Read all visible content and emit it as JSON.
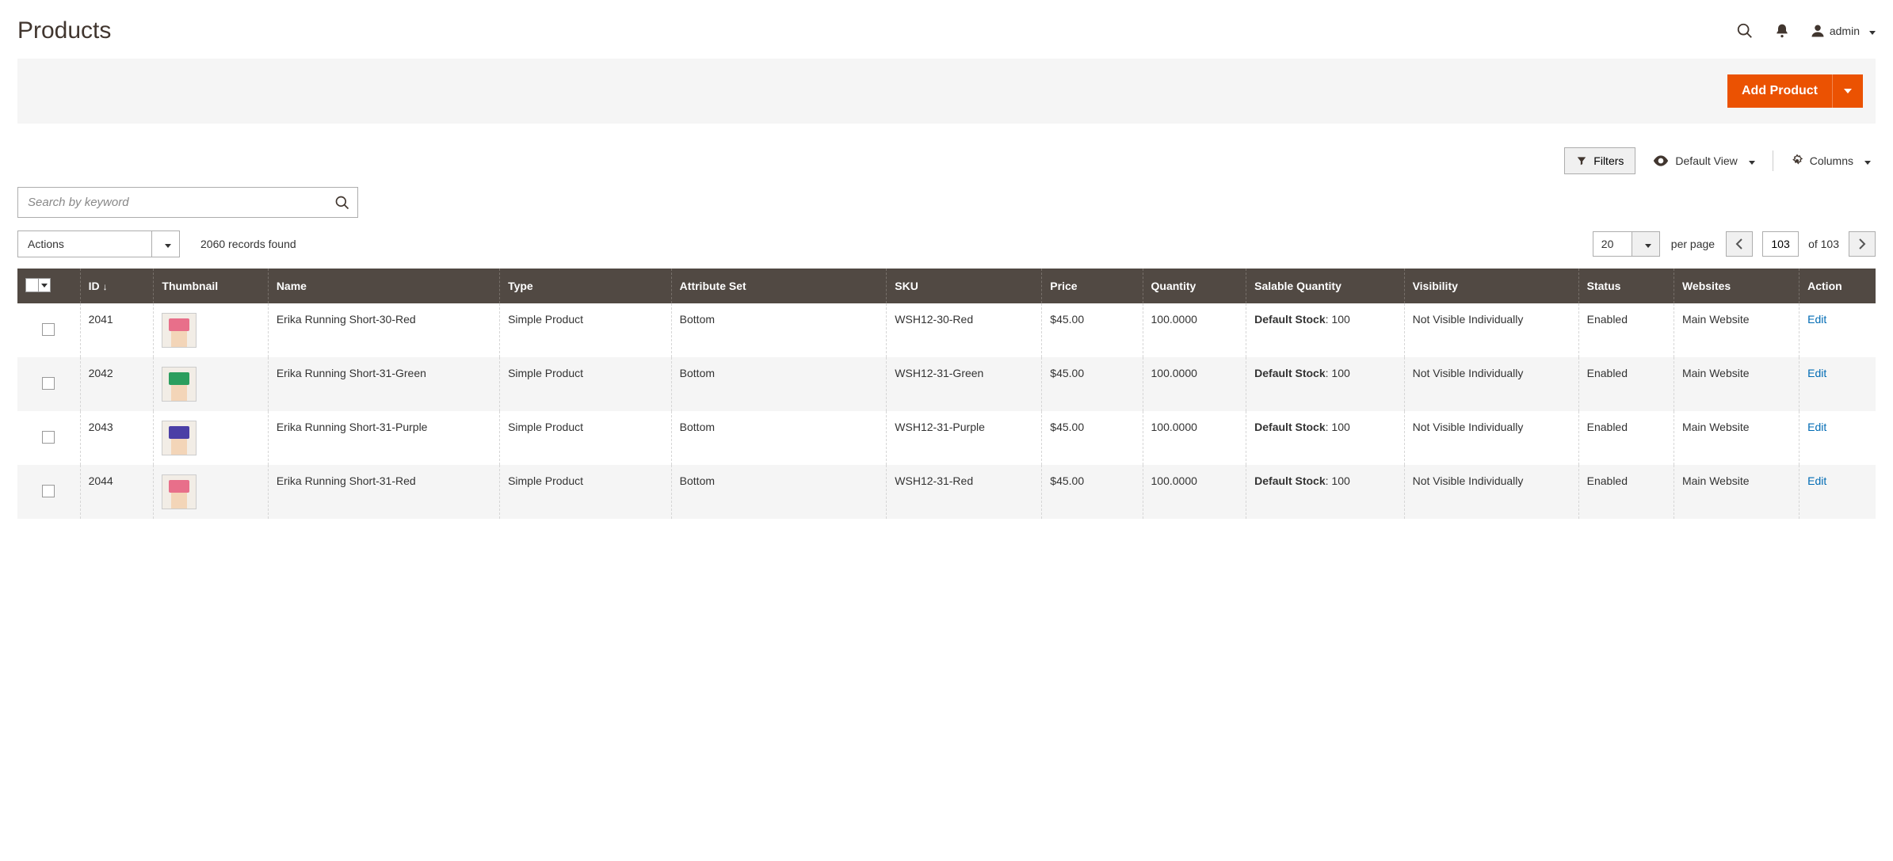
{
  "header": {
    "title": "Products",
    "admin_label": "admin"
  },
  "add_button": {
    "label": "Add Product"
  },
  "toolbar": {
    "filters": "Filters",
    "default_view": "Default View",
    "columns": "Columns"
  },
  "search": {
    "placeholder": "Search by keyword"
  },
  "actions": {
    "label": "Actions"
  },
  "records": {
    "text": "2060 records found"
  },
  "pagination": {
    "page_size": "20",
    "per_page_label": "per page",
    "current_page": "103",
    "of_label": "of 103"
  },
  "columns": {
    "id": "ID",
    "thumbnail": "Thumbnail",
    "name": "Name",
    "type": "Type",
    "attribute_set": "Attribute Set",
    "sku": "SKU",
    "price": "Price",
    "quantity": "Quantity",
    "salable_quantity": "Salable Quantity",
    "visibility": "Visibility",
    "status": "Status",
    "websites": "Websites",
    "action": "Action"
  },
  "rows": [
    {
      "id": "2041",
      "thumb_color": "#e86f8a",
      "name": "Erika Running Short-30-Red",
      "type": "Simple Product",
      "attribute_set": "Bottom",
      "sku": "WSH12-30-Red",
      "price": "$45.00",
      "quantity": "100.0000",
      "salable_label": "Default Stock",
      "salable_value": "100",
      "visibility": "Not Visible Individually",
      "status": "Enabled",
      "websites": "Main Website",
      "action": "Edit"
    },
    {
      "id": "2042",
      "thumb_color": "#2b9e5e",
      "name": "Erika Running Short-31-Green",
      "type": "Simple Product",
      "attribute_set": "Bottom",
      "sku": "WSH12-31-Green",
      "price": "$45.00",
      "quantity": "100.0000",
      "salable_label": "Default Stock",
      "salable_value": "100",
      "visibility": "Not Visible Individually",
      "status": "Enabled",
      "websites": "Main Website",
      "action": "Edit"
    },
    {
      "id": "2043",
      "thumb_color": "#4b3fa6",
      "name": "Erika Running Short-31-Purple",
      "type": "Simple Product",
      "attribute_set": "Bottom",
      "sku": "WSH12-31-Purple",
      "price": "$45.00",
      "quantity": "100.0000",
      "salable_label": "Default Stock",
      "salable_value": "100",
      "visibility": "Not Visible Individually",
      "status": "Enabled",
      "websites": "Main Website",
      "action": "Edit"
    },
    {
      "id": "2044",
      "thumb_color": "#e86f8a",
      "name": "Erika Running Short-31-Red",
      "type": "Simple Product",
      "attribute_set": "Bottom",
      "sku": "WSH12-31-Red",
      "price": "$45.00",
      "quantity": "100.0000",
      "salable_label": "Default Stock",
      "salable_value": "100",
      "visibility": "Not Visible Individually",
      "status": "Enabled",
      "websites": "Main Website",
      "action": "Edit"
    }
  ]
}
